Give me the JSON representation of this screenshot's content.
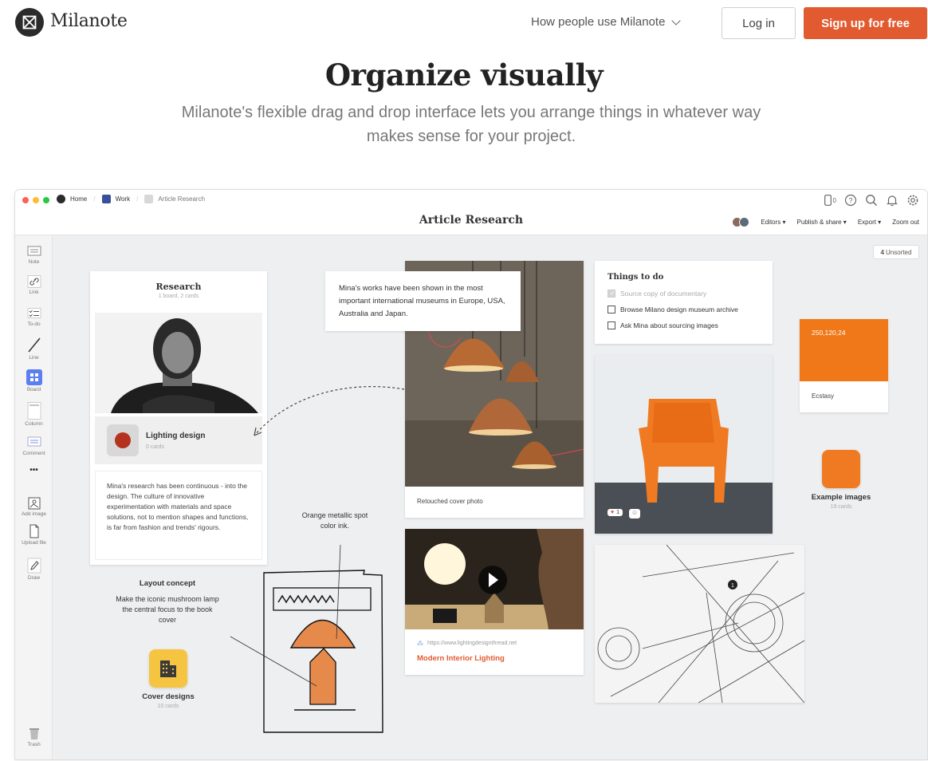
{
  "nav": {
    "logo_text": "Milanote",
    "how_label": "How people use Milanote",
    "login_label": "Log in",
    "signup_label": "Sign up for free"
  },
  "hero": {
    "title": "Organize visually",
    "subtitle_line1": "Milanote's flexible drag and drop interface lets you arrange things in whatever way",
    "subtitle_line2": "makes sense for your project."
  },
  "app": {
    "breadcrumbs": [
      "Home",
      "Work",
      "Article Research"
    ],
    "board_title": "Article Research",
    "device_count": "0",
    "actions": {
      "editors": "Editors",
      "publish": "Publish & share",
      "export": "Export",
      "zoom": "Zoom out"
    },
    "unsorted_count": "4",
    "unsorted_label": "Unsorted",
    "tools": [
      "Note",
      "Link",
      "To-do",
      "Line",
      "Board",
      "Column",
      "Comment",
      "•••",
      "Add image",
      "Upload file",
      "Draw",
      "Trash"
    ]
  },
  "research_board": {
    "title": "Research",
    "meta": "1 board, 2 cards",
    "lighting_title": "Lighting design",
    "lighting_meta": "0 cards",
    "note_text": "Mina's research has been continuous - into the design. The culture of innovative experimentation with materials and space solutions, not to mention shapes and functions, is far from fashion and trends' rigours."
  },
  "quote_card": {
    "text": "Mina's works have been shown in the most important international museums in Europe, USA, Australia and Japan."
  },
  "lamp_card": {
    "caption": "Retouched cover photo"
  },
  "todo": {
    "title": "Things to do",
    "items": [
      {
        "label": "Source copy of documentary",
        "done": true
      },
      {
        "label": "Browse Milano design museum archive",
        "done": false
      },
      {
        "label": "Ask Mina about sourcing images",
        "done": false
      }
    ]
  },
  "swatch": {
    "value": "250,120,24",
    "name": "Ecstasy",
    "color": "#f07818"
  },
  "chair_card": {
    "reaction_count": "1"
  },
  "example_images": {
    "title": "Example images",
    "meta": "19 cards"
  },
  "layout_concept": {
    "title": "Layout concept",
    "text": "Make the iconic mushroom lamp the central focus to the book cover"
  },
  "ink_note": {
    "text": "Orange metallic spot color ink."
  },
  "cover_designs": {
    "title": "Cover designs",
    "meta": "10 cards"
  },
  "video_card": {
    "url": "https://www.lightingdesignthread.net",
    "title": "Modern Interior Lighting"
  },
  "colors": {
    "accent": "#e25a30",
    "orange": "#f07818",
    "board_blue": "#5b7ff0",
    "yellow": "#f5c542"
  }
}
